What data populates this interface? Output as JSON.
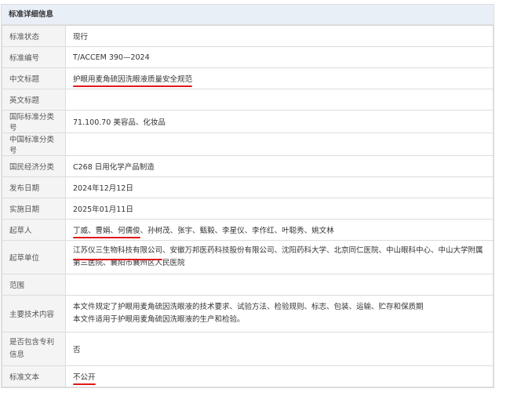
{
  "header": {
    "title": "标准详细信息"
  },
  "rows": {
    "status": {
      "label": "标准状态",
      "value": "现行"
    },
    "number": {
      "label": "标准编号",
      "value": "T/ACCEM 390—2024"
    },
    "cn_title": {
      "label": "中文标题",
      "value": "护眼用麦角硫因洗眼液质量安全规范"
    },
    "en_title": {
      "label": "英文标题",
      "value": ""
    },
    "ics": {
      "label": "国际标准分类号",
      "value": "71.100.70 美容品、化妆品"
    },
    "ccs": {
      "label": "中国标准分类号",
      "value": ""
    },
    "industry": {
      "label": "国民经济分类",
      "value": "C268 日用化学产品制造"
    },
    "pub_date": {
      "label": "发布日期",
      "value": "2024年12月12日"
    },
    "impl_date": {
      "label": "实施日期",
      "value": "2025年01月11日"
    },
    "drafters": {
      "label": "起草人",
      "underlined": [
        "丁威",
        "曹娟",
        "何儒俊"
      ],
      "rest": "、孙树茂、张宇、甄毅、李星仪、李作红、叶聪秀、姚文林"
    },
    "units": {
      "label": "起草单位",
      "underlined": "江苏仪三生物科技有限公司",
      "rest": "、安徽万邦医药科技股份有限公司、沈阳药科大学、北京同仁医院、中山眼科中心、中山大学附属第三医院、襄阳市襄州区人民医院"
    },
    "scope": {
      "label": "范围",
      "value": ""
    },
    "content": {
      "label": "主要技术内容",
      "line1": "本文件规定了护眼用麦角硫因洗眼液的技术要求、试验方法、检验规则、标志、包装、运输、贮存和保质期",
      "line2": "本文件适用于护眼用麦角硫因洗眼液的生产和检验。"
    },
    "patent": {
      "label": "是否包含专利信息",
      "value": "否"
    },
    "text": {
      "label": "标准文本",
      "value": "不公开"
    }
  },
  "colors": {
    "underline": "#e01818",
    "header_bg": "#e9eff6",
    "label_bg": "#f4f4f4",
    "border": "#dcdcdc"
  }
}
